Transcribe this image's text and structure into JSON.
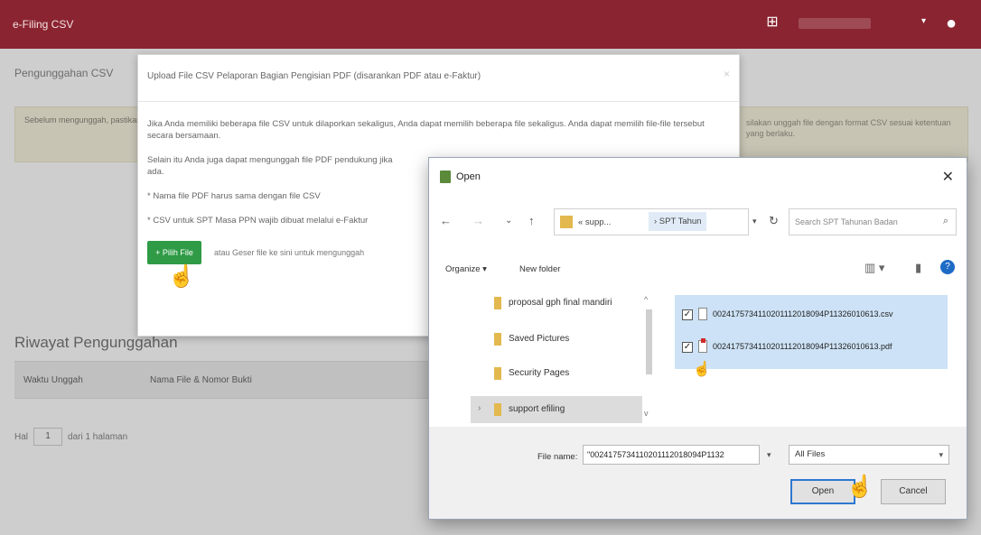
{
  "app": {
    "title": "e-Filing CSV",
    "user_caret": "▾"
  },
  "background_page": {
    "title": "Pengunggahan CSV",
    "info_text": "Sebelum mengunggah, pastikan file CSV telah dibuat menggunakan e-Faktur atau aplikasi lain yang disediakan.",
    "info_right": "silakan unggah file dengan format CSV sesuai ketentuan yang berlaku.",
    "history_title": "Riwayat Pengunggahan",
    "table_headers": [
      "Waktu Unggah",
      "Nama File & Nomor Bukti"
    ],
    "pager_prefix": "Hal",
    "pager_value": "1",
    "pager_suffix": "dari 1 halaman"
  },
  "upload_modal": {
    "header": "Upload File CSV Pelaporan Bagian Pengisian PDF (disarankan PDF atau e-Faktur)",
    "close": "×",
    "paragraphs": [
      "Jika Anda memiliki beberapa file CSV untuk dilaporkan sekaligus, Anda dapat memilih beberapa file sekaligus. Anda dapat memilih file-file tersebut secara bersamaan.",
      "Selain itu Anda juga dapat mengunggah file PDF pendukung jika ada.",
      "* Nama file PDF harus sama dengan file CSV",
      "* CSV untuk SPT Masa PPN wajib dibuat melalui e-Faktur"
    ],
    "browse_label": "+ Pilih File",
    "browse_note": "atau Geser file ke sini untuk mengunggah"
  },
  "open_dialog": {
    "title": "Open",
    "close": "✕",
    "nav": {
      "back": "←",
      "forward": "→",
      "recent": "⌄",
      "up": "↑",
      "crumb_1": "« supp...",
      "crumb_2": "› SPT Tahun",
      "refresh": "↻",
      "search_placeholder": "Search SPT Tahunan Badan"
    },
    "commands": {
      "organize": "Organize ▾",
      "new_folder": "New folder"
    },
    "tree": [
      {
        "label": "proposal gph final mandiri",
        "selected": false
      },
      {
        "label": "Saved Pictures",
        "selected": false
      },
      {
        "label": "Security Pages",
        "selected": false
      },
      {
        "label": "support efiling",
        "selected": true
      }
    ],
    "files": [
      {
        "name": "0024175734110201112018094P11326010613.csv",
        "type": "csv",
        "checked": "✓"
      },
      {
        "name": "0024175734110201112018094P11326010613.pdf",
        "type": "pdf",
        "checked": "✓"
      }
    ],
    "file_name_label": "File name:",
    "file_name_value": "\"0024175734110201112018094P1132",
    "file_type": "All Files",
    "open_button": "Open",
    "cancel_button": "Cancel"
  }
}
